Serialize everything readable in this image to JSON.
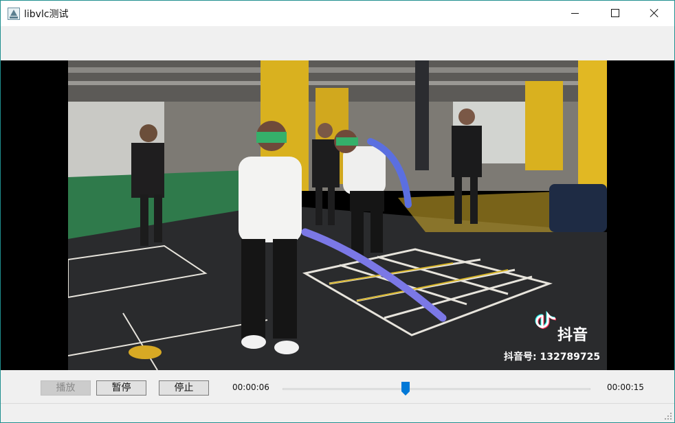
{
  "window": {
    "title": "libvlc测试"
  },
  "video": {
    "description_icon": "tiktok-logo-icon",
    "watermark_name": "抖音",
    "watermark_id": "抖音号: 132789725"
  },
  "controls": {
    "play_label": "播放",
    "pause_label": "暂停",
    "stop_label": "停止",
    "current_time": "00:00:06",
    "total_time": "00:00:15",
    "progress_fraction": 0.4
  },
  "colors": {
    "accent": "#0078d7",
    "window_border": "#1f8f8f"
  }
}
